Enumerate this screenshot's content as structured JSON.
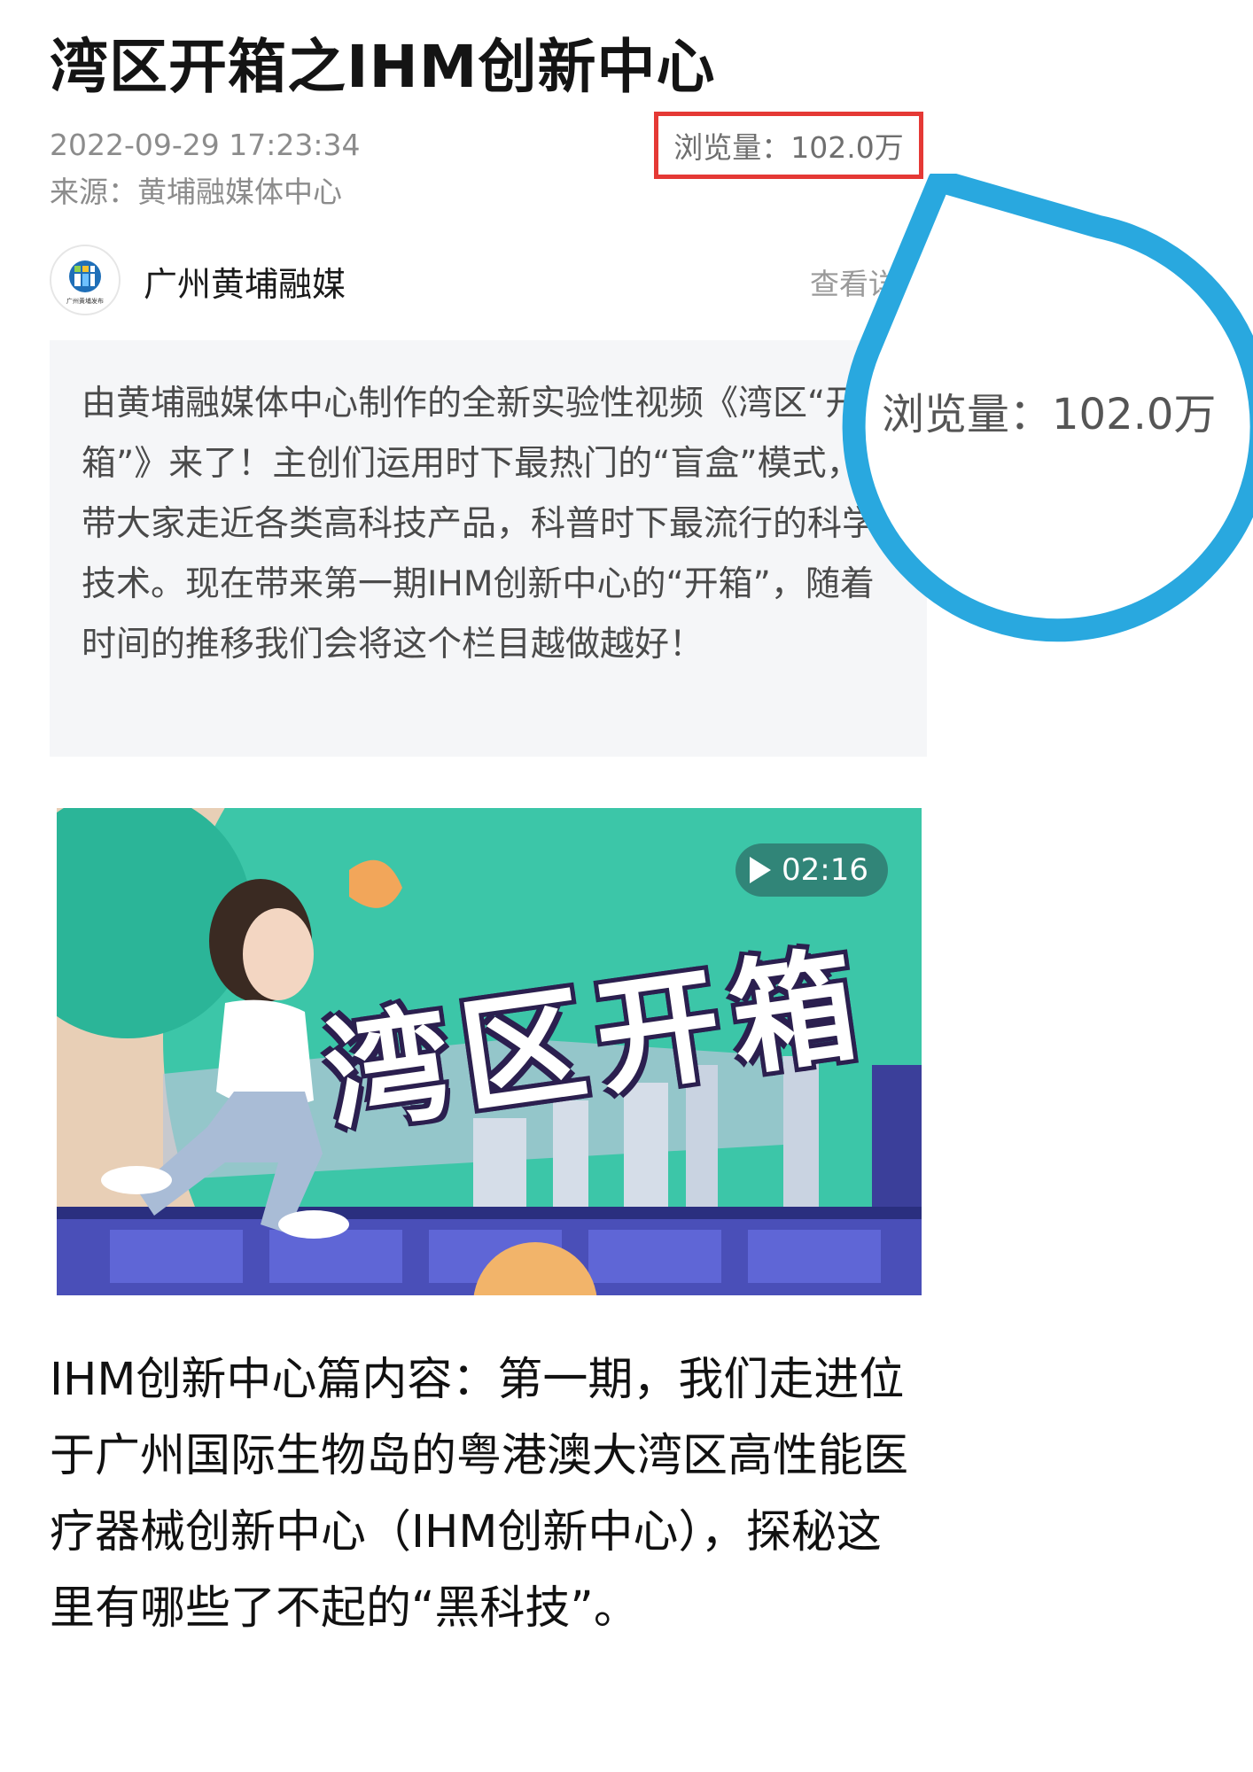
{
  "article": {
    "title": "湾区开箱之IHM创新中心",
    "date": "2022-09-29 17:23:34",
    "source": "来源：黄埔融媒体中心",
    "views": "浏览量：102.0万"
  },
  "account": {
    "name": "广州黄埔融媒",
    "details_link": "查看详情",
    "avatar_caption": "广州黄埔发布"
  },
  "summary": {
    "text": "由黄埔融媒体中心制作的全新实验性视频《湾区“开箱”》来了！主创们运用时下最热门的“盲盒”模式，带大家走近各类高科技产品，科普时下最流行的科学技术。现在带来第一期IHM创新中心的“开箱”，随着时间的推移我们会将这个栏目越做越好！"
  },
  "video": {
    "duration": "02:16",
    "cover_title": "湾区开箱"
  },
  "body": {
    "text": "IHM创新中心篇内容：第一期，我们走进位于广州国际生物岛的粤港澳大湾区高性能医疗器械创新中心（IHM创新中心），探秘这里有哪些了不起的“黑科技”。"
  },
  "zoom_callout": {
    "text": "浏览量：102.0万"
  },
  "colors": {
    "highlight_box": "#e53935",
    "callout_ring": "#29a8df",
    "video_teal": "#3cc6a8"
  }
}
